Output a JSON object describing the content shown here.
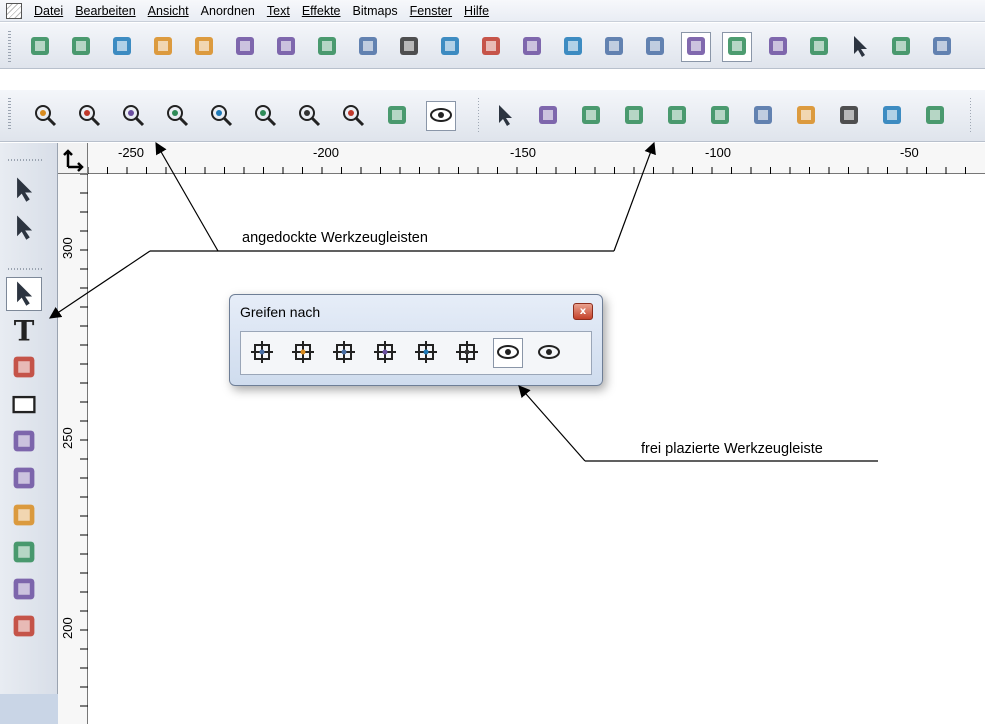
{
  "menu": {
    "items": [
      {
        "label": "Datei"
      },
      {
        "label": "Bearbeiten"
      },
      {
        "label": "Ansicht"
      },
      {
        "label": "Anordnen"
      },
      {
        "label": "Text"
      },
      {
        "label": "Effekte"
      },
      {
        "label": "Bitmaps"
      },
      {
        "label": "Fenster"
      },
      {
        "label": "Hilfe"
      }
    ]
  },
  "standard_toolbar": {
    "icons": [
      "new-document-icon",
      "open-icon",
      "save-icon",
      "import-icon",
      "export-icon",
      "print-icon",
      "plot-icon",
      "publish-icon",
      "stamp-icon",
      "cut-icon",
      "copy-icon",
      "paste-icon",
      "undo-icon",
      "undo-list-icon",
      "redo-icon",
      "redo-list-icon",
      "object-manager-icon",
      "layers-icon",
      "properties-icon",
      "color-palette-icon",
      "color-picker-icon",
      "color-table-icon",
      "color-wheel-icon"
    ]
  },
  "tools_toolbar": {
    "icons": [
      "zoom-area-icon",
      "zoom-in-icon",
      "zoom-page-icon",
      "zoom-out-icon",
      "zoom-selection-icon",
      "zoom-all-icon",
      "zoom-previous-icon",
      "zoom-actual-size-icon",
      "pan-hand-icon",
      "view-mode-icon",
      "marquee-select-icon",
      "lasso-icon",
      "magic-wand-icon",
      "node-move-icon",
      "pencil-icon",
      "brush-icon",
      "marker-icon",
      "fill-bucket-icon",
      "crop-icon",
      "clone-stamp-icon",
      "sparkle-icon"
    ]
  },
  "ruler": {
    "h_labels": [
      "-250",
      "-200",
      "-150",
      "-100",
      "-50"
    ],
    "v_labels": [
      "300",
      "250",
      "200"
    ]
  },
  "toolbox": {
    "tools": [
      "select-arrow-icon",
      "node-select-icon",
      "pick-tool-icon",
      "text-tool-icon",
      "pen-tool-icon",
      "rectangle-tool-icon",
      "fill-tool-icon",
      "zigzag-tool-icon",
      "shape-tool-icon",
      "transform-tool-icon",
      "dimension-tool-icon",
      "eyedropper-icon"
    ]
  },
  "annotations": {
    "docked": "angedockte Werkzeugleisten",
    "floating": "frei plazierte Werkzeugleiste"
  },
  "floating_toolbar": {
    "title": "Greifen nach",
    "close_label": "x",
    "buttons": [
      "snap-grid-icon",
      "snap-object-icon",
      "snap-intersect-icon",
      "snap-shape-icon",
      "snap-guide-icon",
      "snap-bounds-icon",
      "view-guides-icon",
      "view-grid-icon"
    ]
  }
}
